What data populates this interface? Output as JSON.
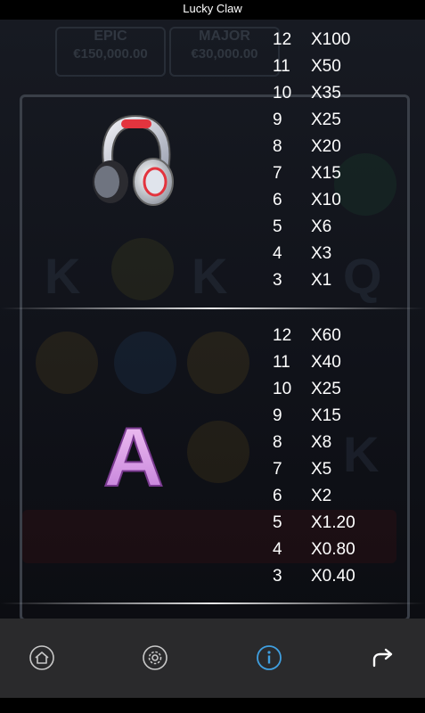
{
  "window": {
    "title": "Lucky Claw"
  },
  "background": {
    "jackpots": [
      {
        "label": "EPIC",
        "amount": "€150,000.00"
      },
      {
        "label": "MAJOR",
        "amount": "€30,000.00"
      }
    ]
  },
  "paytables": [
    {
      "symbol": "headphones-symbol",
      "rows": [
        {
          "count": "12",
          "mult": "X100"
        },
        {
          "count": "11",
          "mult": "X50"
        },
        {
          "count": "10",
          "mult": "X35"
        },
        {
          "count": "9",
          "mult": "X25"
        },
        {
          "count": "8",
          "mult": "X20"
        },
        {
          "count": "7",
          "mult": "X15"
        },
        {
          "count": "6",
          "mult": "X10"
        },
        {
          "count": "5",
          "mult": "X6"
        },
        {
          "count": "4",
          "mult": "X3"
        },
        {
          "count": "3",
          "mult": "X1"
        }
      ]
    },
    {
      "symbol": "letter-a-symbol",
      "letter": "A",
      "rows": [
        {
          "count": "12",
          "mult": "X60"
        },
        {
          "count": "11",
          "mult": "X40"
        },
        {
          "count": "10",
          "mult": "X25"
        },
        {
          "count": "9",
          "mult": "X15"
        },
        {
          "count": "8",
          "mult": "X8"
        },
        {
          "count": "7",
          "mult": "X5"
        },
        {
          "count": "6",
          "mult": "X2"
        },
        {
          "count": "5",
          "mult": "X1.20"
        },
        {
          "count": "4",
          "mult": "X0.80"
        },
        {
          "count": "3",
          "mult": "X0.40"
        }
      ]
    }
  ],
  "toolbar": {
    "buttons": [
      {
        "name": "home-button",
        "icon": "home-icon"
      },
      {
        "name": "settings-button",
        "icon": "gear-icon"
      },
      {
        "name": "info-button",
        "icon": "info-icon",
        "active": true
      },
      {
        "name": "share-button",
        "icon": "share-arrow-icon"
      }
    ],
    "colors": {
      "active": "#3f9fe0",
      "inactive": "#c8c8c8",
      "background": "#2a2a2c"
    }
  }
}
